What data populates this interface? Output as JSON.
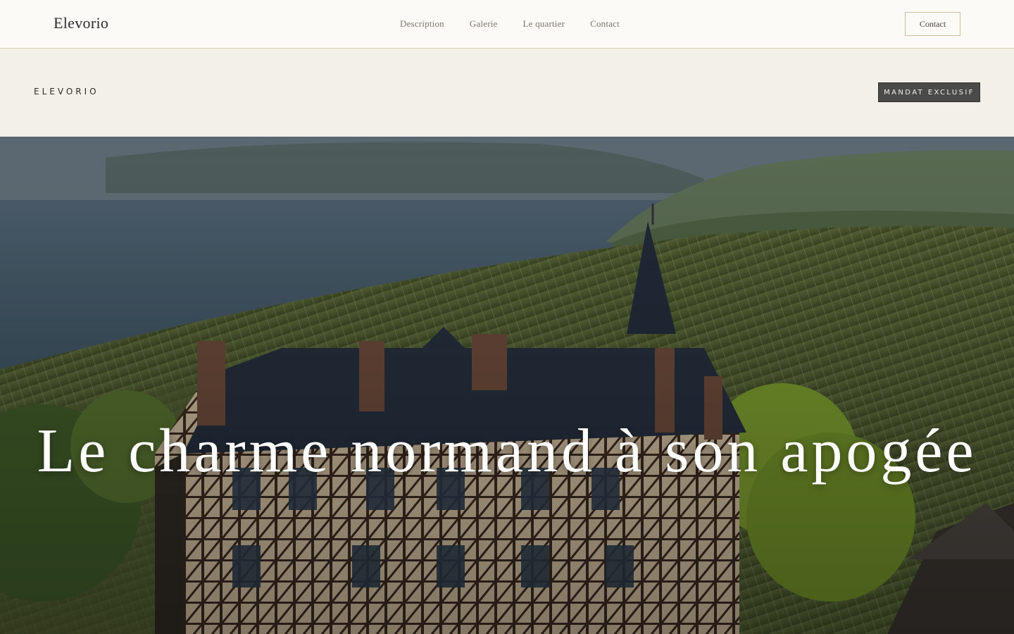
{
  "header": {
    "brand": "Elevorio",
    "nav": [
      {
        "label": "Description"
      },
      {
        "label": "Galerie"
      },
      {
        "label": "Le quartier"
      },
      {
        "label": "Contact"
      }
    ],
    "contact_button": "Contact"
  },
  "subheader": {
    "brand": "ELEVORIO",
    "badge": "MANDAT EXCLUSIF"
  },
  "hero": {
    "title": "Le charme normand à son apogée",
    "image": "normandy-manor-vineyard-coast"
  },
  "colors": {
    "background": "#fbfaf6",
    "subheader_bg": "#f3f0e9",
    "accent_border": "#d8cfb6",
    "badge_bg": "#4a4a48",
    "hero_text": "#ffffff"
  }
}
